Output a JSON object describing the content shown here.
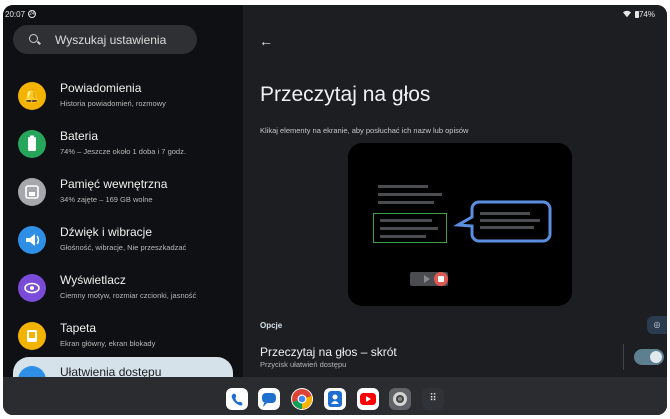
{
  "status_bar": {
    "time": "20:07",
    "dnd_badge": "24",
    "battery": "74%"
  },
  "search": {
    "placeholder": "Wyszukaj ustawienia"
  },
  "settings_list": [
    {
      "title": "Powiadomienia",
      "subtitle": "Historia powiadomień, rozmowy",
      "icon": "bell-icon",
      "color": "#f2b400"
    },
    {
      "title": "Bateria",
      "subtitle": "74% – Jeszcze około 1 doba i 7 godz.",
      "icon": "battery-icon",
      "color": "#26a65b"
    },
    {
      "title": "Pamięć wewnętrzna",
      "subtitle": "34% zajęte – 169 GB wolne",
      "icon": "storage-icon",
      "color": "#a4a8ad"
    },
    {
      "title": "Dźwięk i wibracje",
      "subtitle": "Głośność, wibracje, Nie przeszkadzać",
      "icon": "volume-icon",
      "color": "#2f8fe6"
    },
    {
      "title": "Wyświetlacz",
      "subtitle": "Ciemny motyw, rozmiar czcionki, jasność",
      "icon": "display-icon",
      "color": "#7a4bd9"
    },
    {
      "title": "Tapeta",
      "subtitle": "Ekran główny, ekran blokady",
      "icon": "wallpaper-icon",
      "color": "#f2b400"
    },
    {
      "title": "Ułatwienia dostępu",
      "subtitle": "",
      "icon": "accessibility-icon",
      "color": "#2f8fe6"
    }
  ],
  "detail": {
    "title": "Przeczytaj na głos",
    "description": "Klikaj elementy na ekranie, aby posłuchać ich nazw lub opisów",
    "options_header": "Opcje",
    "shortcut_title": "Przeczytaj na głos – skrót",
    "shortcut_subtitle": "Przycisk ułatwień dostępu",
    "shortcut_enabled": true
  },
  "dock_apps": [
    "phone-icon",
    "messages-icon",
    "chrome-icon",
    "contacts-icon",
    "youtube-icon",
    "camera-icon",
    "app-drawer-icon"
  ],
  "colors": {
    "accent": "#d6e2ea",
    "toggle": "#5d7f8f",
    "highlight_green": "#38a14a",
    "bubble_blue": "#5a8fe0"
  }
}
